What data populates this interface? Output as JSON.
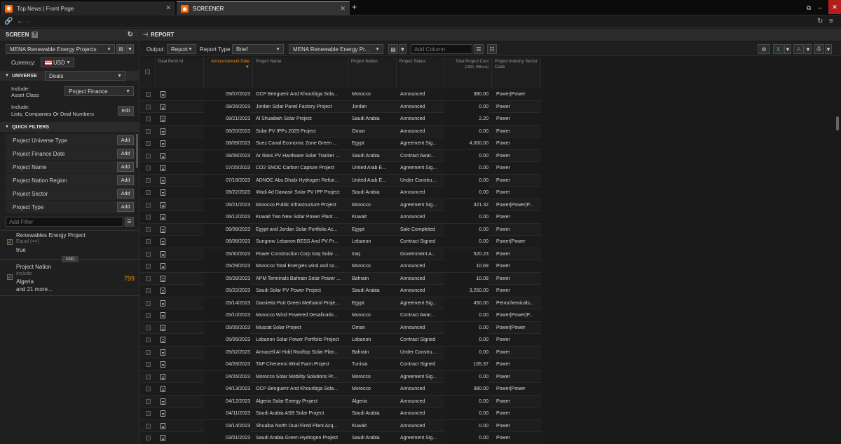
{
  "tabs": [
    {
      "label": "Top News | Front Page"
    },
    {
      "label": "SCREENER"
    }
  ],
  "screen_panel": {
    "title": "SCREEN",
    "help": "?",
    "screen_name": "MENA Renewable Energy Projects",
    "currency_label": "Currency:",
    "currency_value": "USD",
    "universe_label": "UNIVERSE",
    "universe_value": "Deals",
    "include1_label": "Include:",
    "include1_sub": "Asset Class",
    "include1_value": "Project Finance",
    "include2_label": "Include:",
    "include2_sub": "Lists, Companies Or Deal Numbers",
    "edit_label": "Edit",
    "quick_filters_label": "QUICK FILTERS",
    "quick_filters": [
      {
        "label": "Project Universe Type",
        "btn": "Add"
      },
      {
        "label": "Project Finance Date",
        "btn": "Add"
      },
      {
        "label": "Project Name",
        "btn": "Add"
      },
      {
        "label": "Project Nation Region",
        "btn": "Add"
      },
      {
        "label": "Project Sector",
        "btn": "Add"
      },
      {
        "label": "Project Type",
        "btn": "Add"
      }
    ],
    "add_filter_placeholder": "Add Filter",
    "criteria1": {
      "title": "Renewables Energy Project",
      "op": "Equal (==)",
      "value": "true"
    },
    "and_label": "AND",
    "criteria2": {
      "title": "Project Nation",
      "op": "Include",
      "value": "Algeria",
      "more": "and 21 more...",
      "count": "799"
    }
  },
  "report_panel": {
    "title": "REPORT",
    "output_label": "Output:",
    "output_value": "Report",
    "report_type_label": "Report Type",
    "report_type_value": "Brief",
    "screen_value": "MENA Renewable Energy Pr...",
    "add_column_placeholder": "Add Column"
  },
  "table": {
    "columns": [
      "Deal Perm Id",
      "Announcement Date",
      "Project Name",
      "Project Nation",
      "Project Status",
      "Total Project Cost",
      "(USD, Millions)",
      "Project Industry Sector Code"
    ],
    "rows": [
      [
        "09/07/2023",
        "OCP Benguerir And Khouribga Sola...",
        "Morocco",
        "Announced",
        "380.00",
        "Power|Power"
      ],
      [
        "08/26/2023",
        "Jordan Solar Panel Factory Project",
        "Jordan",
        "Announced",
        "0.00",
        "Power"
      ],
      [
        "08/21/2023",
        "Al Shuaibah Solar Project",
        "Saudi Arabia",
        "Announced",
        "2.20",
        "Power"
      ],
      [
        "08/20/2023",
        "Solar PV IPPs 2029 Project",
        "Oman",
        "Announced",
        "0.00",
        "Power"
      ],
      [
        "08/09/2023",
        "Suez Canal Economic Zone Green ...",
        "Egypt",
        "Agreement Sig...",
        "4,000.00",
        "Power"
      ],
      [
        "08/08/2023",
        "Ar Rass PV Hardware Solar Tracker ...",
        "Saudi Arabia",
        "Contract Awar...",
        "0.00",
        "Power"
      ],
      [
        "07/25/2023",
        "CO2 SNOC Carbon Capture Project",
        "United Arab E...",
        "Agreement Sig...",
        "0.00",
        "Power"
      ],
      [
        "07/18/2023",
        "ADNOC Abu Dhabi Hydrogen Refue...",
        "United Arab E...",
        "Under Constru...",
        "0.00",
        "Power"
      ],
      [
        "06/22/2023",
        "Wadi Ad Dawasir Solar PV IPP Project",
        "Saudi Arabia",
        "Announced",
        "0.00",
        "Power"
      ],
      [
        "06/21/2023",
        "Morocco Public Infrastructure Project",
        "Morocco",
        "Agreement Sig...",
        "321.32",
        "Power|Power|P..."
      ],
      [
        "06/12/2023",
        "Kuwait Two New Solar Power Plant ...",
        "Kuwait",
        "Announced",
        "0.00",
        "Power"
      ],
      [
        "06/08/2023",
        "Egypt and Jordan Solar Portfolio Ac...",
        "Egypt",
        "Sale Completed",
        "0.00",
        "Power"
      ],
      [
        "06/06/2023",
        "Sungrow Lebanon BESS And PV Pr...",
        "Lebanon",
        "Contract Signed",
        "0.00",
        "Power|Power"
      ],
      [
        "05/30/2023",
        "Power Construction Corp Iraq Solar ...",
        "Iraq",
        "Government A...",
        "520.23",
        "Power"
      ],
      [
        "05/29/2023",
        "Morocco Total Energies wind and so...",
        "Morocco",
        "Announced",
        "10.69",
        "Power"
      ],
      [
        "05/28/2023",
        "APM Terminals Bahrain Solar Power ...",
        "Bahrain",
        "Announced",
        "10.08",
        "Power"
      ],
      [
        "05/22/2023",
        "Saudi Solar PV Power Project",
        "Saudi Arabia",
        "Announced",
        "3,250.00",
        "Power"
      ],
      [
        "05/14/2023",
        "Damietta Port Green Methanol Proje...",
        "Egypt",
        "Agreement Sig...",
        "450.00",
        "Petrochemicals..."
      ],
      [
        "05/10/2023",
        "Morocco Wind Powered Desalinatio...",
        "Morocco",
        "Contract Awar...",
        "0.00",
        "Power|Power|P..."
      ],
      [
        "05/05/2023",
        "Muscat Solar Project",
        "Oman",
        "Announced",
        "0.00",
        "Power|Power"
      ],
      [
        "05/05/2023",
        "Lebanon Solar Power Portfolio Project",
        "Lebanon",
        "Contract Signed",
        "0.00",
        "Power"
      ],
      [
        "05/02/2023",
        "Armacell Al Hidd Rooftop Solar Plan...",
        "Bahrain",
        "Under Constru...",
        "0.00",
        "Power"
      ],
      [
        "04/28/2023",
        "TAP Chenenni Wind Farm Project",
        "Tunisia",
        "Contract Signed",
        "165.37",
        "Power"
      ],
      [
        "04/26/2023",
        "Morocco Solar Mobility Solutions Pr...",
        "Morocco",
        "Agreement Sig...",
        "0.00",
        "Power"
      ],
      [
        "04/13/2023",
        "OCP Benguerir And Khouribga Sola...",
        "Morocco",
        "Announced",
        "380.00",
        "Power|Power"
      ],
      [
        "04/12/2023",
        "Algeria Solar Energy Project",
        "Algeria",
        "Announced",
        "0.00",
        "Power"
      ],
      [
        "04/11/2023",
        "Saudi Arabia ASB Solar Project",
        "Saudi Arabia",
        "Announced",
        "0.00",
        "Power"
      ],
      [
        "03/14/2023",
        "Shuaiba North Dual Fired Plant Acq...",
        "Kuwait",
        "Announced",
        "0.00",
        "Power"
      ],
      [
        "03/01/2023",
        "Saudi Arabia Green Hydrogen Project",
        "Saudi Arabia",
        "Agreement Sig...",
        "0.00",
        "Power"
      ]
    ]
  },
  "colors": {
    "accent": "#ff8a00",
    "background": "#1a1a1a",
    "close": "#b21d1d",
    "excel": "#1e7a3a",
    "pdf": "#c0392b"
  }
}
